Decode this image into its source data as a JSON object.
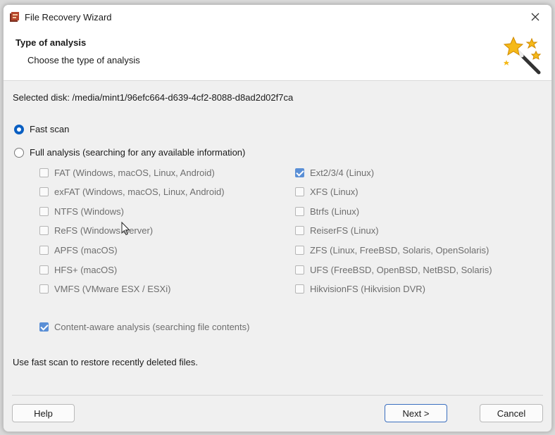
{
  "window": {
    "title": "File Recovery Wizard"
  },
  "header": {
    "title": "Type of analysis",
    "subtitle": "Choose the type of analysis"
  },
  "selected_disk": "Selected disk: /media/mint1/96efc664-d639-4cf2-8088-d8ad2d02f7ca",
  "analysis": {
    "fast_scan": {
      "label": "Fast scan",
      "selected": true
    },
    "full_analysis": {
      "label": "Full analysis (searching for any available information)",
      "selected": false
    }
  },
  "filesystems_left": [
    {
      "label": "FAT (Windows, macOS, Linux, Android)",
      "checked": false
    },
    {
      "label": "exFAT (Windows, macOS, Linux, Android)",
      "checked": false
    },
    {
      "label": "NTFS (Windows)",
      "checked": false
    },
    {
      "label": "ReFS (Windows Server)",
      "checked": false
    },
    {
      "label": "APFS (macOS)",
      "checked": false
    },
    {
      "label": "HFS+ (macOS)",
      "checked": false
    },
    {
      "label": "VMFS (VMware ESX / ESXi)",
      "checked": false
    }
  ],
  "filesystems_right": [
    {
      "label": "Ext2/3/4 (Linux)",
      "checked": true
    },
    {
      "label": "XFS (Linux)",
      "checked": false
    },
    {
      "label": "Btrfs (Linux)",
      "checked": false
    },
    {
      "label": "ReiserFS (Linux)",
      "checked": false
    },
    {
      "label": "ZFS (Linux, FreeBSD, Solaris, OpenSolaris)",
      "checked": false
    },
    {
      "label": "UFS (FreeBSD, OpenBSD, NetBSD, Solaris)",
      "checked": false
    },
    {
      "label": "HikvisionFS (Hikvision DVR)",
      "checked": false
    }
  ],
  "content_aware": {
    "label": "Content-aware analysis (searching file contents)",
    "checked": true
  },
  "hint": "Use fast scan to restore recently deleted files.",
  "buttons": {
    "help": "Help",
    "next": "Next >",
    "cancel": "Cancel"
  },
  "icons": {
    "app": "app-icon",
    "close": "close-icon",
    "wizard": "magic-wand-icon",
    "cursor": "mouse-cursor-icon"
  },
  "colors": {
    "accent": "#0a5fc2",
    "checkbox_checked": "#5a8fd6"
  }
}
